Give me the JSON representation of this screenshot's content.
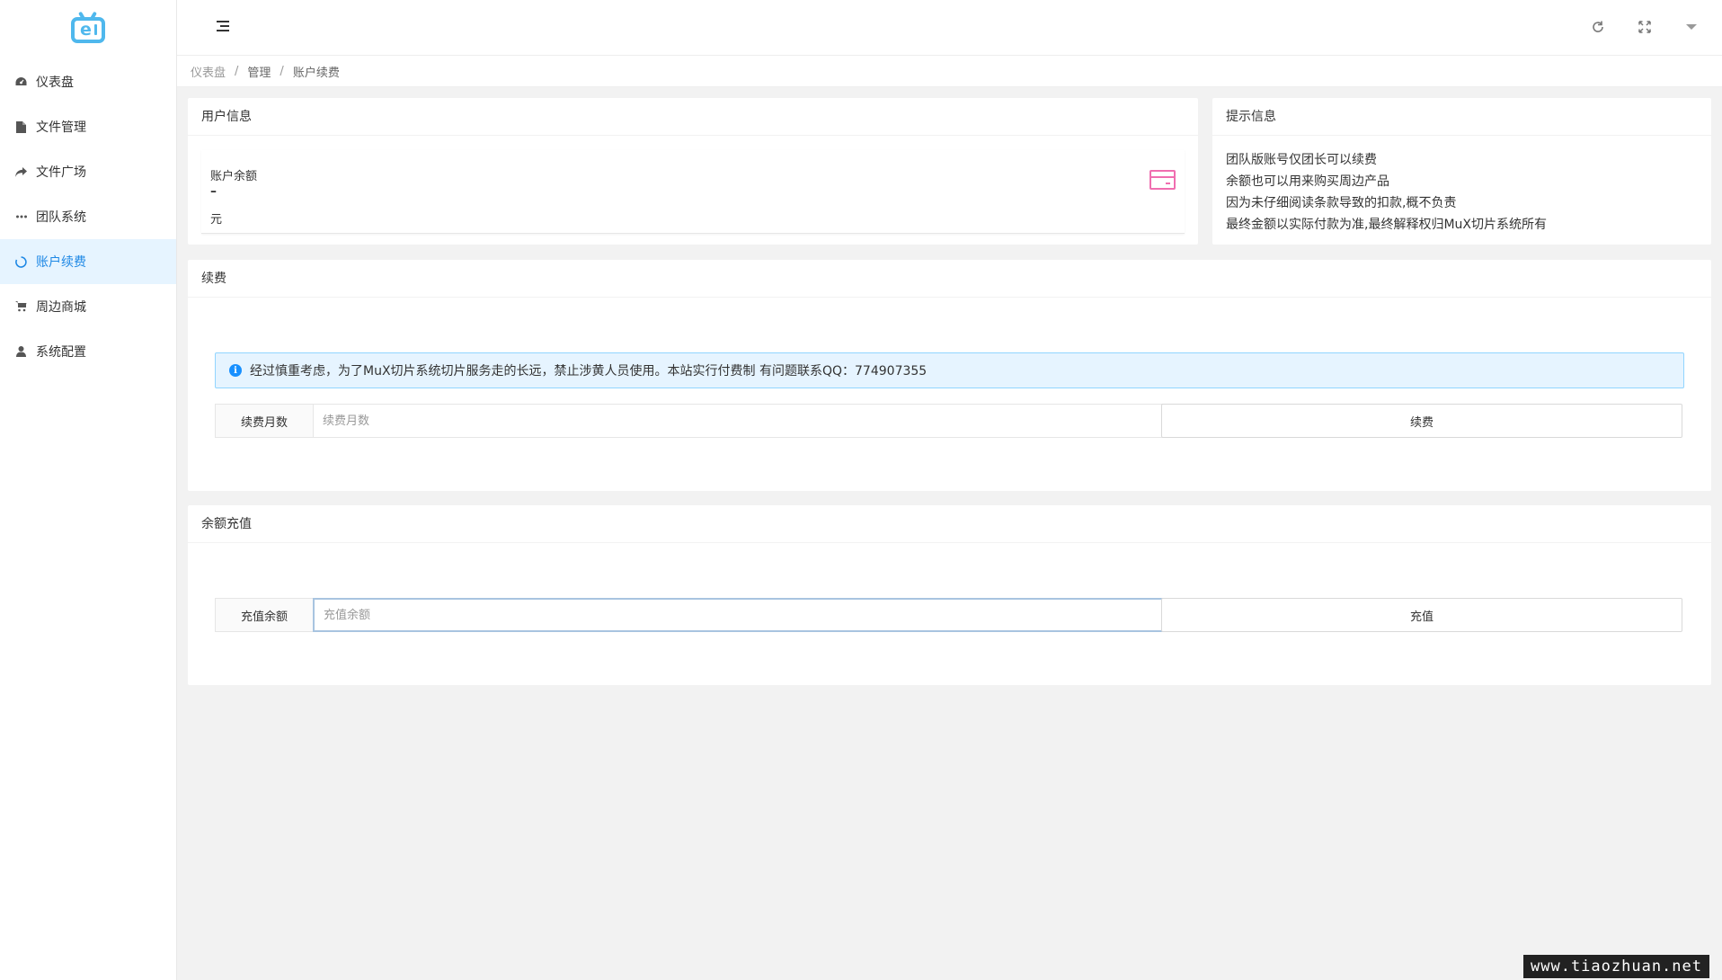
{
  "sidebar": {
    "logo": "e",
    "items": [
      {
        "label": "仪表盘",
        "icon": "dashboard-icon"
      },
      {
        "label": "文件管理",
        "icon": "file-icon"
      },
      {
        "label": "文件广场",
        "icon": "share-icon"
      },
      {
        "label": "团队系统",
        "icon": "ellipsis-icon"
      },
      {
        "label": "账户续费",
        "icon": "circle-icon",
        "active": true
      },
      {
        "label": "周边商城",
        "icon": "cart-icon"
      },
      {
        "label": "系统配置",
        "icon": "user-icon"
      }
    ]
  },
  "breadcrumb": [
    "仪表盘",
    "管理",
    "账户续费"
  ],
  "user_info": {
    "title": "用户信息",
    "balance_label": "账户余额",
    "balance_value": "–",
    "balance_unit": "元"
  },
  "tips": {
    "title": "提示信息",
    "lines": [
      "团队版账号仅团长可以续费",
      "余额也可以用来购买周边产品",
      "因为未仔细阅读条款导致的扣款,概不负责",
      "最终金额以实际付款为准,最终解释权归MuX切片系统所有"
    ]
  },
  "renew": {
    "title": "续费",
    "notice": "经过慎重考虑，为了MuX切片系统切片服务走的长远，禁止涉黄人员使用。本站实行付费制 有问题联系QQ：774907355",
    "months_label": "续费月数",
    "months_placeholder": "续费月数",
    "button": "续费"
  },
  "recharge": {
    "title": "余额充值",
    "amount_label": "充值余额",
    "amount_placeholder": "充值余额",
    "button": "充值"
  },
  "watermark": "www.tiaozhuan.net",
  "colors": {
    "accent": "#1e88e5",
    "logo": "#4fb8ed",
    "card_icon": "#f06eb0",
    "alert_bg": "#e6f4ff"
  }
}
